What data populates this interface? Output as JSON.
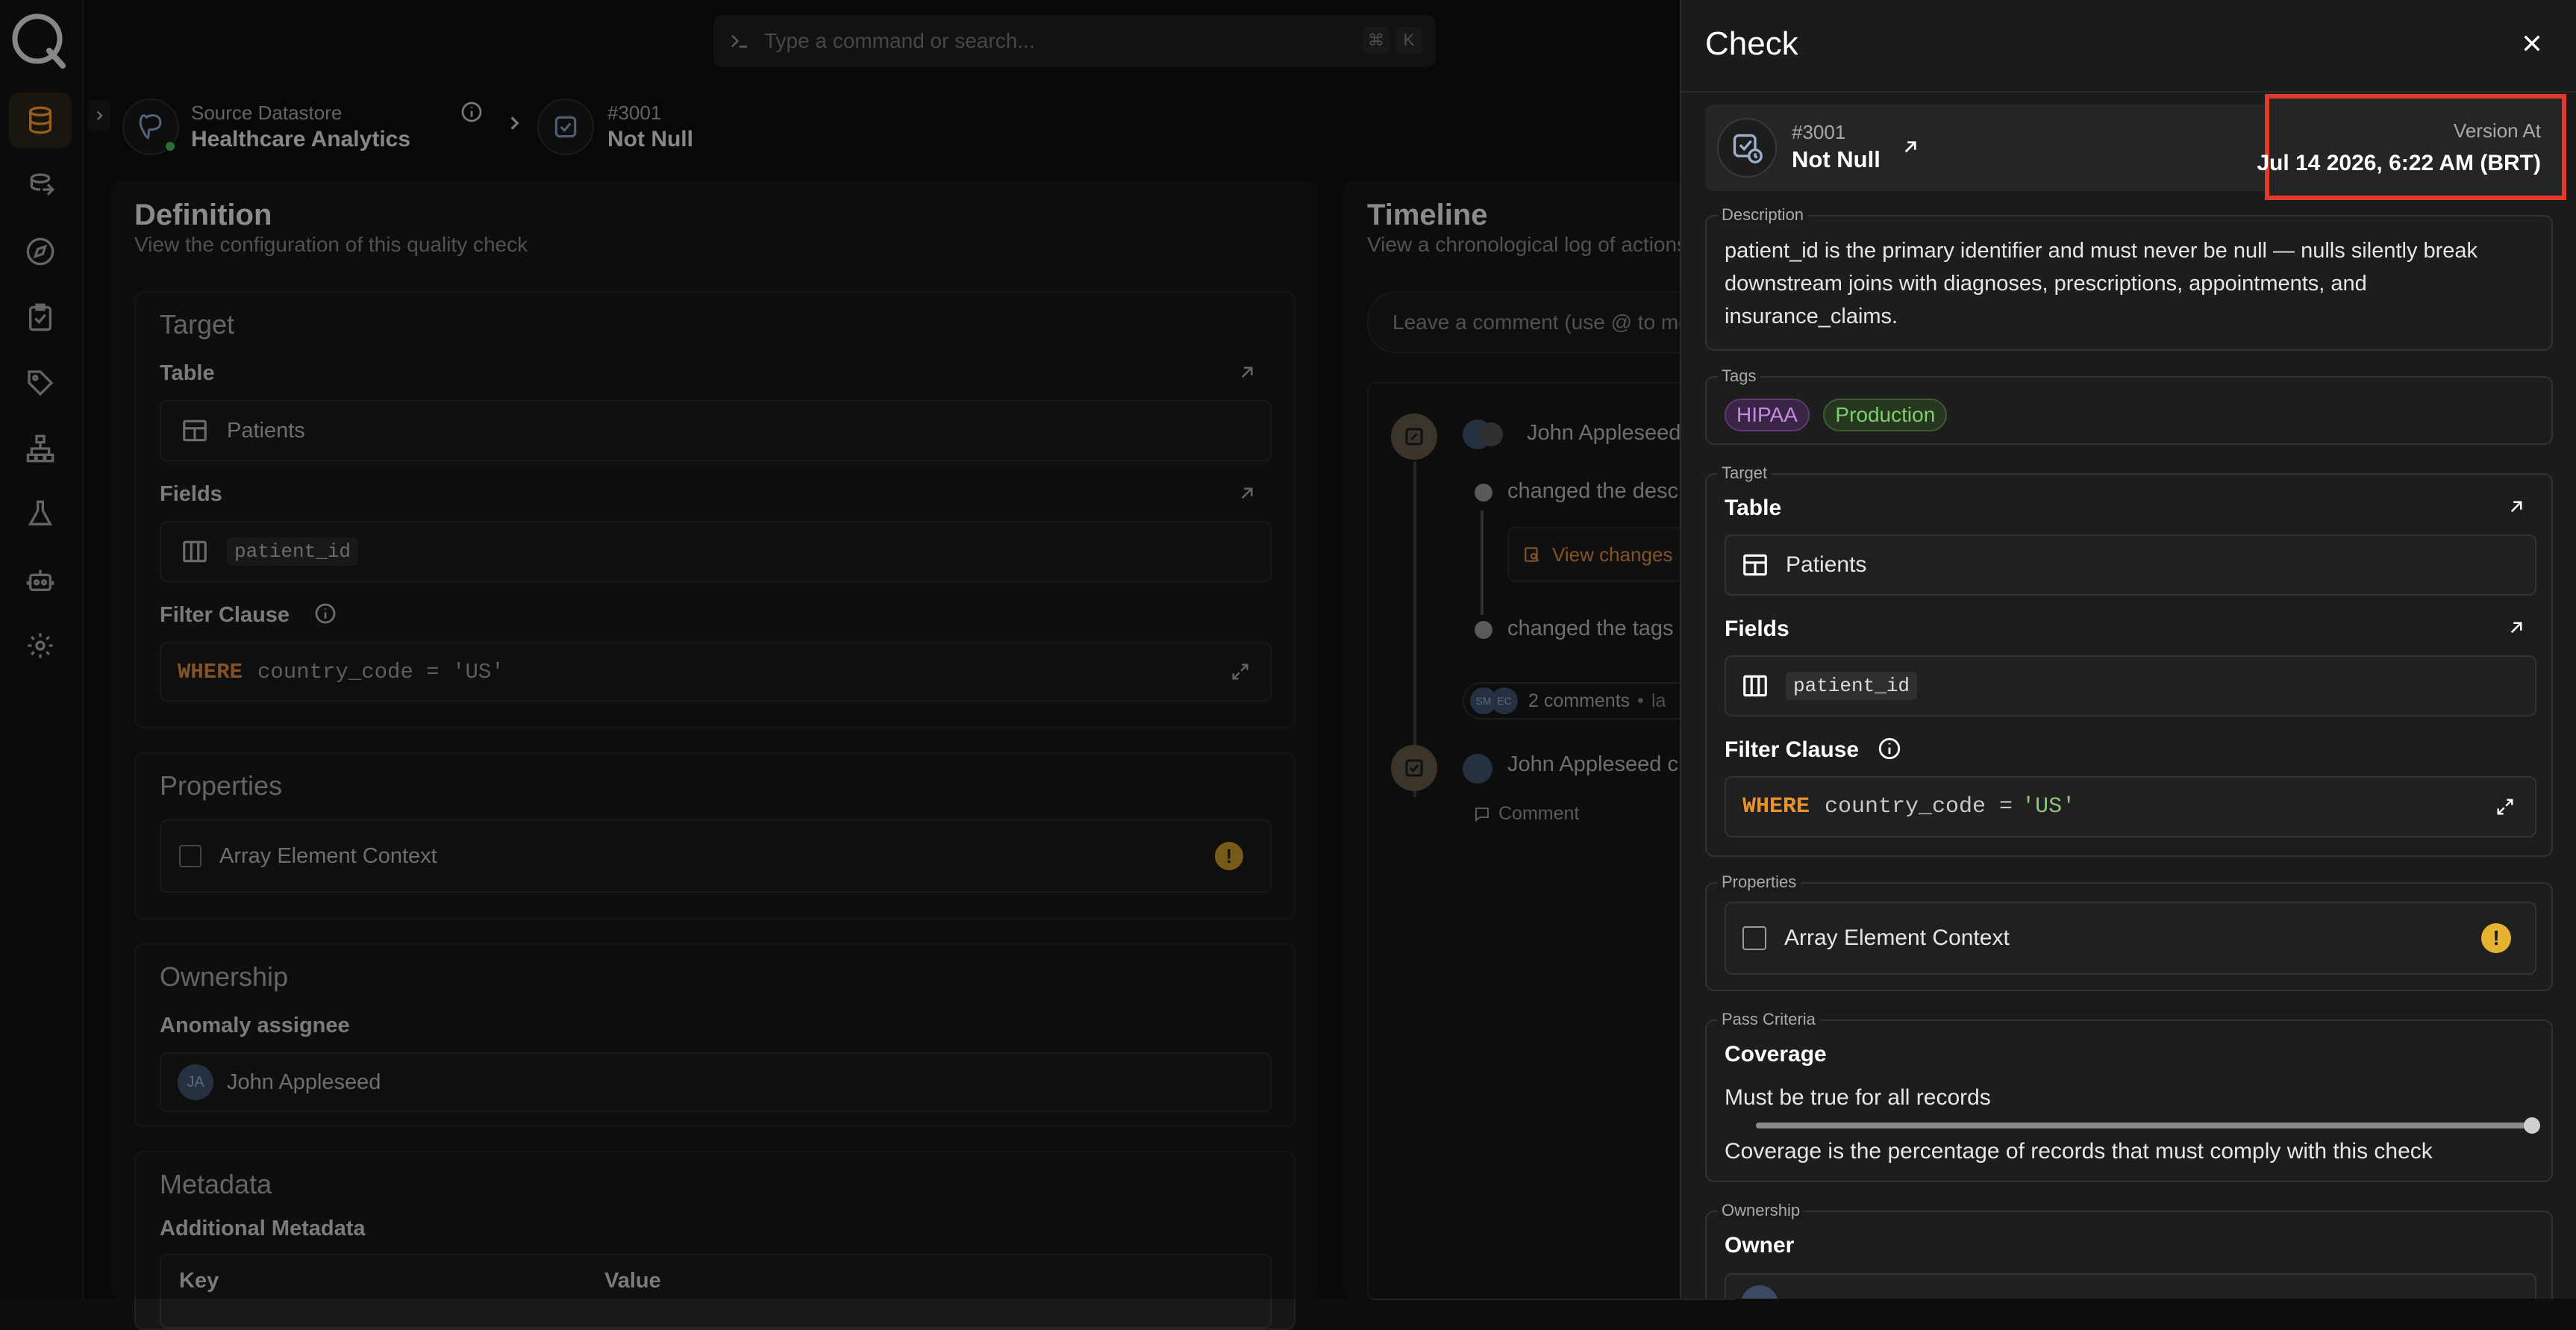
{
  "search": {
    "placeholder": "Type a command or search...",
    "shortcut_mod": "⌘",
    "shortcut_key": "K"
  },
  "breadcrumb": {
    "datastore_label": "Source Datastore",
    "datastore_name": "Healthcare Analytics",
    "check_id": "#3001",
    "check_name": "Not Null"
  },
  "definition": {
    "title": "Definition",
    "subtitle": "View the configuration of this quality check",
    "target": {
      "title": "Target",
      "table_label": "Table",
      "table_value": "Patients",
      "fields_label": "Fields",
      "field_value": "patient_id",
      "filter_label": "Filter Clause",
      "filter_keyword": "WHERE",
      "filter_expr": "country_code = 'US'"
    },
    "properties": {
      "title": "Properties",
      "option": "Array Element Context"
    },
    "ownership": {
      "title": "Ownership",
      "assignee_label": "Anomaly assignee",
      "assignee_initials": "JA",
      "assignee_name": "John Appleseed"
    },
    "metadata": {
      "title": "Metadata",
      "additional_label": "Additional Metadata",
      "col_key": "Key",
      "col_value": "Value"
    }
  },
  "timeline": {
    "title": "Timeline",
    "subtitle": "View a chronological log of actions",
    "comment_placeholder": "Leave a comment (use @ to mention)",
    "entry1_user": "John Appleseed",
    "entry1_action1": "changed the description",
    "entry1_view_changes": "View changes",
    "entry1_action2": "changed the tags",
    "entry1_comment_count": "2 comments",
    "entry1_sep": "•",
    "entry1_time": "la",
    "entry1_av1": "SM",
    "entry1_av2": "EC",
    "entry2_user": "John Appleseed created this check",
    "entry2_comment": "Comment"
  },
  "drawer": {
    "title": "Check",
    "header": {
      "id": "#3001",
      "name": "Not Null",
      "version_label": "Version At",
      "version_value": "Jul 14 2026, 6:22 AM (BRT)"
    },
    "description_legend": "Description",
    "description": "patient_id is the primary identifier and must never be null — nulls silently break downstream joins with diagnoses, prescriptions, appointments, and insurance_claims.",
    "tags_legend": "Tags",
    "tags": [
      "HIPAA",
      "Production"
    ],
    "target_legend": "Target",
    "table_label": "Table",
    "table_value": "Patients",
    "fields_label": "Fields",
    "field_value": "patient_id",
    "filter_label": "Filter Clause",
    "filter_keyword": "WHERE",
    "filter_expr_prefix": "country_code = ",
    "filter_expr_value": "'US'",
    "properties_legend": "Properties",
    "property_option": "Array Element Context",
    "pass_legend": "Pass Criteria",
    "coverage_label": "Coverage",
    "coverage_rule": "Must be true for all records",
    "coverage_value": 1.0,
    "coverage_help": "Coverage is the percentage of records that must comply with this check",
    "ownership_legend": "Ownership",
    "owner_label": "Owner"
  },
  "colors": {
    "accent": "#e8912d",
    "highlight_box": "#e03a2a",
    "tag_hipaa": "#c48be0",
    "tag_production": "#7ccf6a"
  }
}
